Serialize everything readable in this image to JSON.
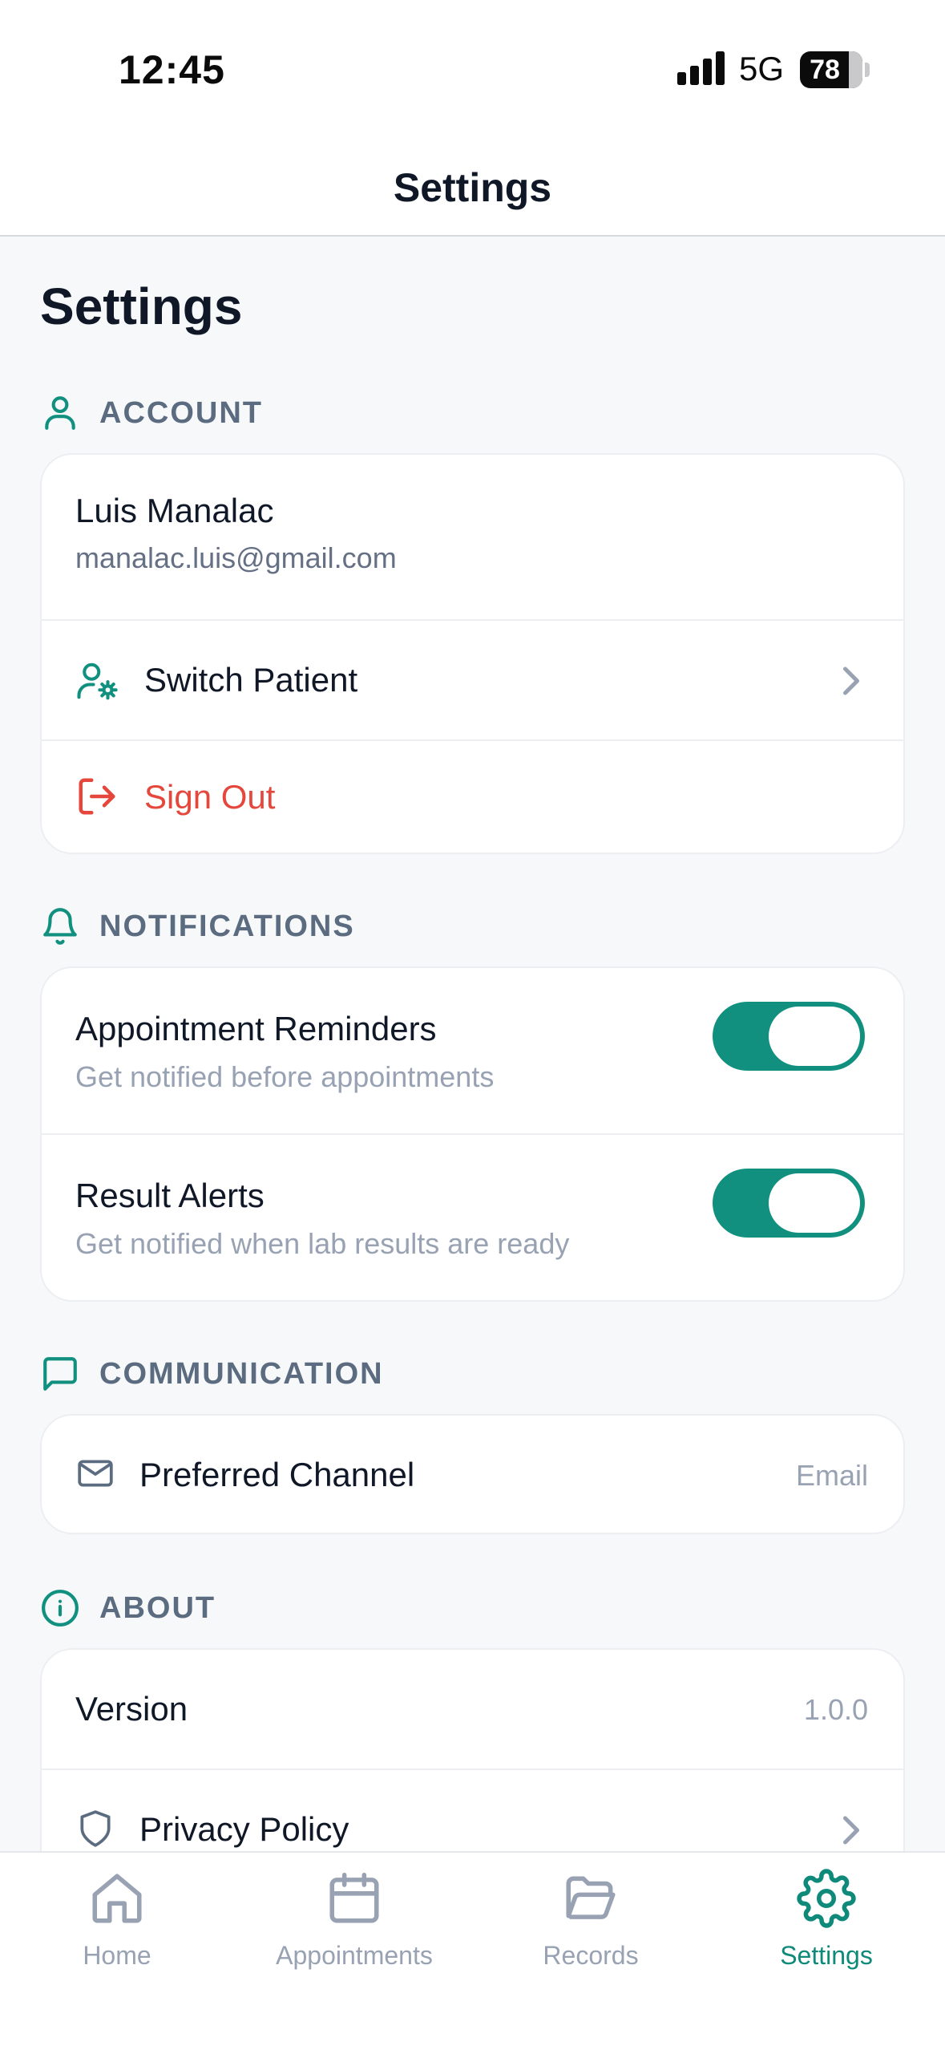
{
  "status_bar": {
    "time": "12:45",
    "network": "5G",
    "battery": "78",
    "battery_level": 0.78
  },
  "header": {
    "title": "Settings"
  },
  "page": {
    "heading": "Settings"
  },
  "account": {
    "section_label": "ACCOUNT",
    "user_name": "Luis Manalac",
    "user_email": "manalac.luis@gmail.com",
    "switch_patient_label": "Switch Patient",
    "sign_out_label": "Sign Out"
  },
  "notifications": {
    "section_label": "NOTIFICATIONS",
    "items": [
      {
        "title": "Appointment Reminders",
        "subtitle": "Get notified before appointments",
        "enabled": true
      },
      {
        "title": "Result Alerts",
        "subtitle": "Get notified when lab results are ready",
        "enabled": true
      }
    ]
  },
  "communication": {
    "section_label": "COMMUNICATION",
    "preferred_channel_label": "Preferred Channel",
    "preferred_channel_value": "Email"
  },
  "about": {
    "section_label": "ABOUT",
    "version_label": "Version",
    "version_value": "1.0.0",
    "privacy_label": "Privacy Policy"
  },
  "tabs": [
    {
      "label": "Home",
      "icon": "home-icon",
      "active": false
    },
    {
      "label": "Appointments",
      "icon": "calendar-icon",
      "active": false
    },
    {
      "label": "Records",
      "icon": "folder-open-icon",
      "active": false
    },
    {
      "label": "Settings",
      "icon": "gear-icon",
      "active": true
    }
  ],
  "colors": {
    "accent": "#11907f",
    "danger": "#e5473c",
    "section_text": "#5b6b80",
    "inactive_tab": "#98a2b3"
  }
}
